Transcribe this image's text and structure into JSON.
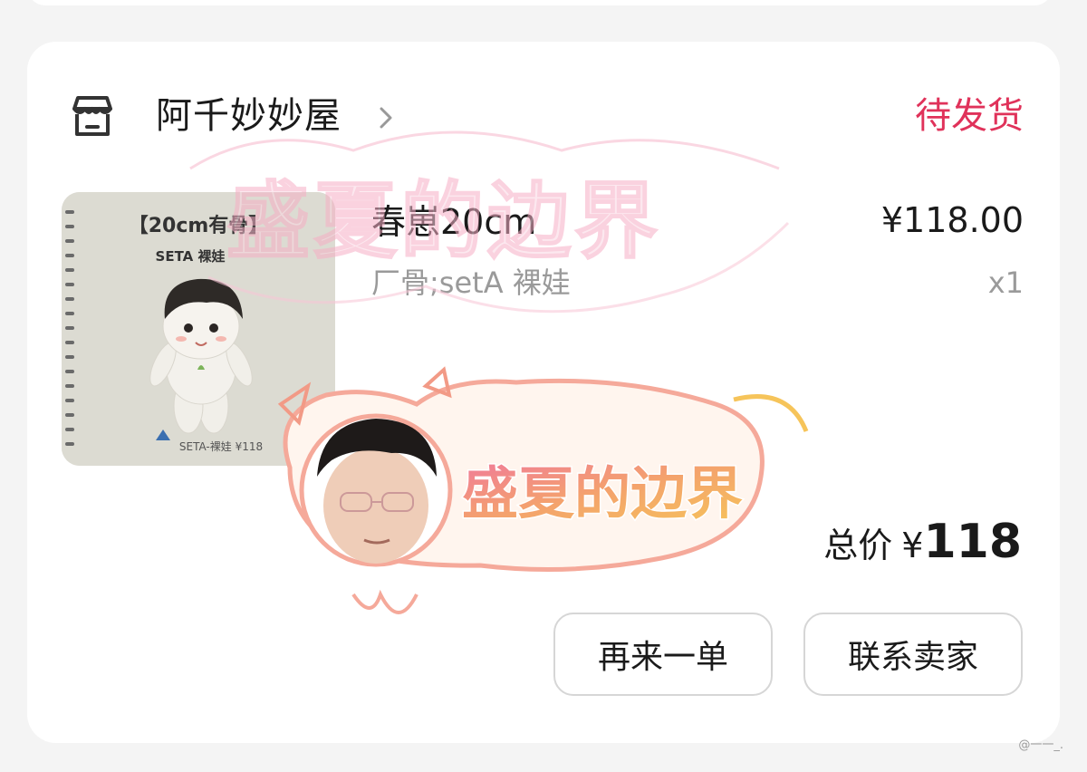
{
  "shop": {
    "name": "阿千妙妙屋",
    "status": "待发货",
    "icon": "shop-icon"
  },
  "product": {
    "name": "春崽20cm",
    "spec": "厂骨;setA 裸娃",
    "price": "¥118.00",
    "quantity": "x1",
    "thumbnail": {
      "header": "【20cm有骨】",
      "subheader": "SETA 裸娃",
      "tag": "SETA-裸娃 ¥118"
    }
  },
  "total": {
    "label": "总价",
    "currency": "¥",
    "amount": "118"
  },
  "actions": {
    "reorder": "再来一单",
    "contact_seller": "联系卖家"
  },
  "sticker": {
    "text": "盛夏的边界"
  },
  "watermark": "@一一_.",
  "colors": {
    "status": "#e0325a",
    "background": "#f4f4f4",
    "card": "#ffffff"
  }
}
